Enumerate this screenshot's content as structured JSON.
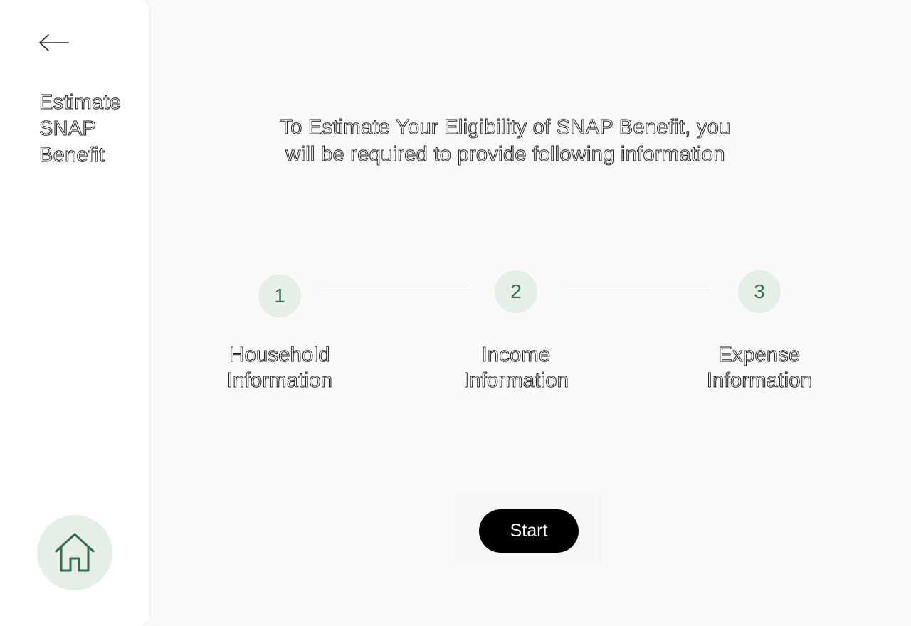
{
  "sidebar": {
    "title_lines": [
      "Estimate",
      "SNAP",
      "Benefit"
    ],
    "back_icon": "arrow-left-icon",
    "home_icon": "home-icon"
  },
  "main": {
    "headline_lines": [
      "To Estimate Your Eligibility of SNAP Benefit, you",
      "will be required to provide following information"
    ],
    "steps": [
      {
        "number": "1",
        "label_lines": [
          "Household",
          "Information"
        ]
      },
      {
        "number": "2",
        "label_lines": [
          "Income",
          "Information"
        ]
      },
      {
        "number": "3",
        "label_lines": [
          "Expense",
          "Information"
        ]
      }
    ],
    "start_label": "Start"
  },
  "colors": {
    "accent_green": "#356b4e",
    "circle_bg": "#e6eee8",
    "button_bg": "#000000",
    "page_bg": "#f9f9f9",
    "sidebar_bg": "#ffffff"
  }
}
